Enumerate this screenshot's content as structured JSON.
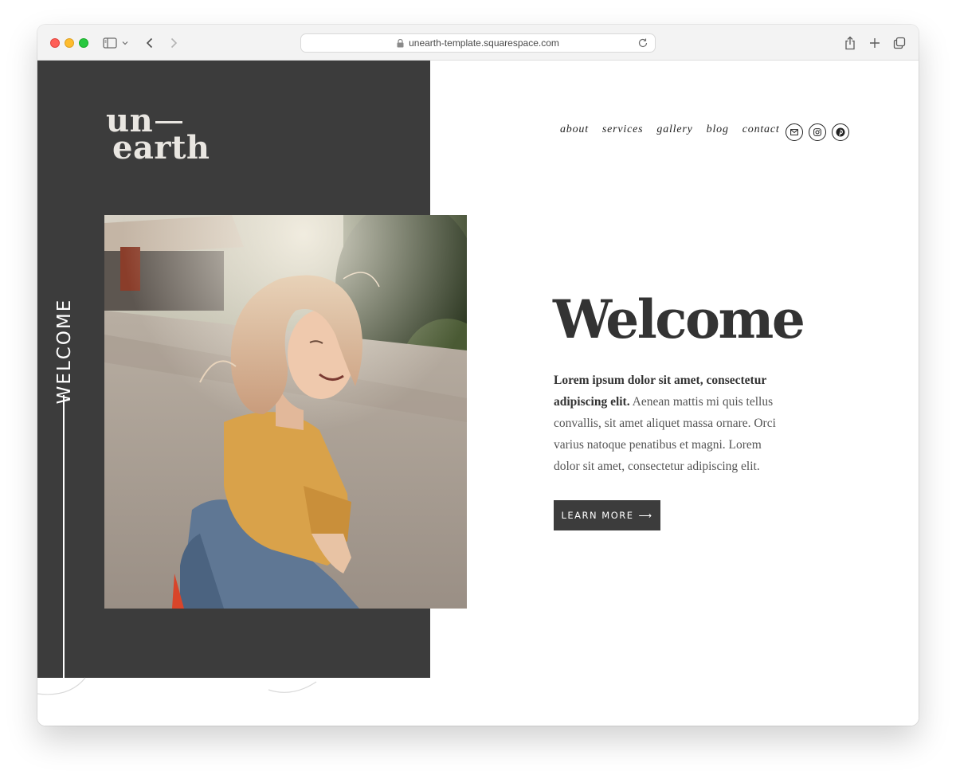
{
  "browser": {
    "url": "unearth-template.squarespace.com"
  },
  "site": {
    "logo": {
      "line1": "un",
      "line2": "earth"
    },
    "side_label": "WELCOME",
    "nav": {
      "items": [
        {
          "label": "about"
        },
        {
          "label": "services"
        },
        {
          "label": "gallery"
        },
        {
          "label": "blog"
        },
        {
          "label": "contact"
        }
      ],
      "social": [
        {
          "icon": "mail-icon"
        },
        {
          "icon": "instagram-icon"
        },
        {
          "icon": "pinterest-icon"
        }
      ]
    },
    "hero": {
      "headline": "Welcome",
      "lead_bold": "Lorem ipsum dolor sit amet, consectetur adipiscing elit.",
      "lead_rest": " Aenean mattis mi quis tellus convallis, sit amet aliquet massa ornare. Orci varius natoque penatibus et magni. Lorem dolor sit amet, consectetur adipiscing elit.",
      "cta_label": "LEARN MORE",
      "cta_arrow": "⟶"
    }
  },
  "colors": {
    "dark_panel": "#3c3c3c",
    "text_dark": "#333333",
    "chrome_bg": "#f3f3f3"
  }
}
